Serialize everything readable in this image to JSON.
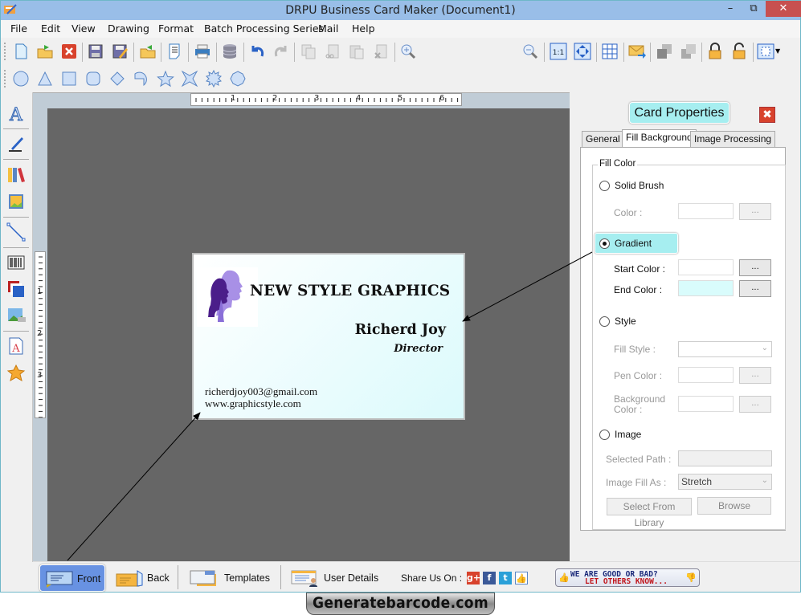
{
  "window": {
    "title": "DRPU Business Card Maker (Document1)",
    "minimize": "–",
    "maximize": "⧉",
    "close": "✕"
  },
  "menu": [
    "File",
    "Edit",
    "View",
    "Drawing",
    "Format",
    "Batch Processing Series",
    "Mail",
    "Help"
  ],
  "toolbar": {
    "icons": [
      "new-icon",
      "open-icon",
      "close-doc-icon",
      "save-icon",
      "save-as-icon",
      "export-icon",
      "page-setup-icon",
      "print-icon",
      "database-icon",
      "undo-icon",
      "redo-icon",
      "copy-icon",
      "cut-icon",
      "paste-icon",
      "delete-icon",
      "zoom-in-icon",
      "zoom-out-icon",
      "actual-size-icon",
      "fit-window-icon",
      "grid-icon",
      "mail-icon",
      "bring-front-icon",
      "send-back-icon",
      "lock-icon",
      "unlock-icon",
      "align-icon"
    ],
    "zoom_value": "100%"
  },
  "shapes": [
    "ellipse-icon",
    "triangle-icon",
    "rectangle-icon",
    "rounded-rect-icon",
    "diamond-icon",
    "arc-icon",
    "star5-icon",
    "star4-icon",
    "burst-icon",
    "polygon-icon"
  ],
  "left_tools": [
    "text-icon",
    "pen-icon",
    "library-icon",
    "picture-icon",
    "line-icon",
    "barcode-icon",
    "background-icon",
    "image-icon",
    "watermark-icon",
    "symbol-icon"
  ],
  "ruler": {
    "h": [
      "1",
      "2",
      "3",
      "4",
      "5",
      "6"
    ],
    "v": [
      "1",
      "2",
      "3"
    ]
  },
  "card": {
    "company": "NEW STYLE GRAPHICS",
    "name": "Richerd Joy",
    "role": "Director",
    "email": "richerdjoy003@gmail.com",
    "website": "www.graphicstyle.com",
    "gradient_start": "#ffffff",
    "gradient_end": "#dbfafc"
  },
  "properties": {
    "title": "Card Properties",
    "close": "✖",
    "tabs": [
      "General",
      "Fill Background",
      "Image Processing"
    ],
    "active_tab": "Fill Background",
    "group_label": "Fill Color",
    "solid_brush": "Solid Brush",
    "color_label": "Color :",
    "gradient": "Gradient",
    "start_color_label": "Start Color :",
    "end_color_label": "End Color :",
    "end_color_value": "#d9fcfc",
    "style": "Style",
    "fill_style_label": "Fill Style :",
    "pen_color_label": "Pen Color :",
    "background_color_label": "Background Color :",
    "image": "Image",
    "selected_path_label": "Selected Path :",
    "image_fill_label": "Image Fill As :",
    "image_fill_value": "Stretch",
    "select_library": "Select From Library",
    "browse": "Browse",
    "dots": "...",
    "selected_option": "Gradient"
  },
  "bottom": {
    "front": "Front",
    "back": "Back",
    "templates": "Templates",
    "user_details": "User Details",
    "share_label": "Share Us On :",
    "feedback_line1": "WE ARE GOOD OR BAD?",
    "feedback_line2": "LET OTHERS KNOW..."
  },
  "watermark": "Generatebarcode.com"
}
